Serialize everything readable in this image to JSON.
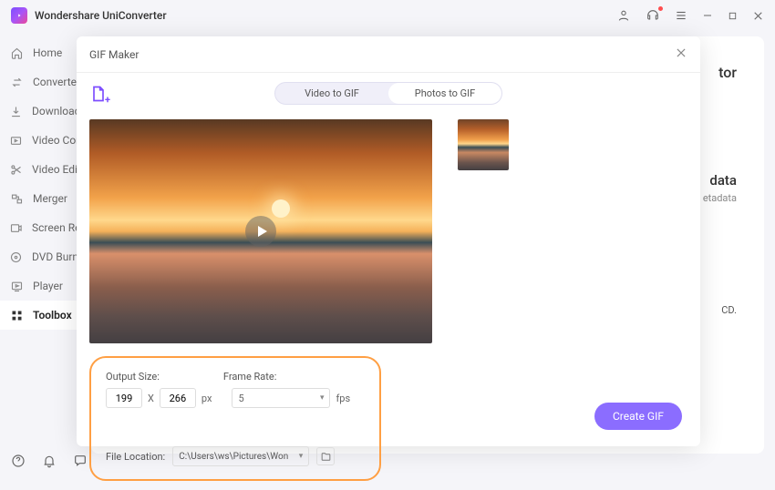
{
  "titlebar": {
    "title": "Wondershare UniConverter"
  },
  "sidebar": {
    "items": [
      {
        "label": "Home",
        "icon": "home"
      },
      {
        "label": "Converter",
        "icon": "convert"
      },
      {
        "label": "Downloader",
        "icon": "download"
      },
      {
        "label": "Video Compressor",
        "icon": "compress"
      },
      {
        "label": "Video Editor",
        "icon": "scissors"
      },
      {
        "label": "Merger",
        "icon": "merge"
      },
      {
        "label": "Screen Recorder",
        "icon": "record"
      },
      {
        "label": "DVD Burner",
        "icon": "disc"
      },
      {
        "label": "Player",
        "icon": "play"
      },
      {
        "label": "Toolbox",
        "icon": "grid"
      }
    ]
  },
  "content_hint": {
    "right_label_1": "tor",
    "right_label_2": "data",
    "right_label_3": "etadata",
    "right_label_4": "CD."
  },
  "modal": {
    "title": "GIF Maker",
    "tabs": {
      "video": "Video to GIF",
      "photos": "Photos to GIF"
    },
    "options": {
      "output_size_label": "Output Size:",
      "frame_rate_label": "Frame Rate:",
      "width": "199",
      "times": "X",
      "height": "266",
      "unit": "px",
      "fps_value": "5",
      "fps_unit": "fps",
      "file_location_label": "File Location:",
      "file_location_value": "C:\\Users\\ws\\Pictures\\Wonders"
    },
    "create_label": "Create GIF"
  }
}
